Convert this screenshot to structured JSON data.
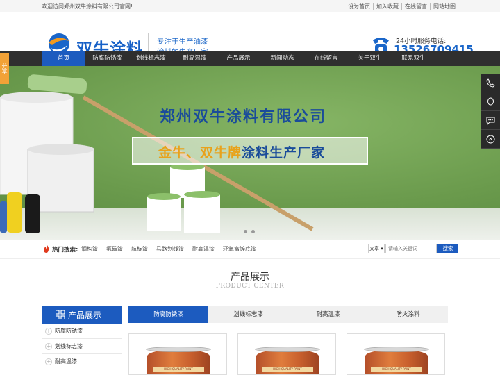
{
  "topbar": {
    "welcome": "欢迎访问郑州双牛涂料有限公司官网!",
    "links": [
      "设为首页",
      "加入收藏",
      "在线留言",
      "网站地图"
    ]
  },
  "header": {
    "brand": "双牛涂料",
    "slogan1": "专注于生产油漆",
    "slogan2": "涂料的生产厂家",
    "hotline_label": "24小时服务电话:",
    "hotline": "13526709415"
  },
  "nav": [
    "首页",
    "防腐防锈漆",
    "划线标志漆",
    "耐高温漆",
    "产品展示",
    "新闻动态",
    "在线留言",
    "关于双牛",
    "联系双牛"
  ],
  "banner": {
    "title": "郑州双牛涂料有限公司",
    "sub_gold": "金牛、双牛牌",
    "sub_blue": "涂料生产厂家"
  },
  "search": {
    "hot_label": "热门搜索:",
    "hot_words": [
      "钢构漆",
      "氟碳漆",
      "航标漆",
      "马路划线漆",
      "耐高温漆",
      "环氧富锌底漆"
    ],
    "select": "文章",
    "placeholder": "请输入关键词",
    "button": "搜索"
  },
  "section": {
    "title": "产品展示",
    "subtitle": "PRODUCT CENTER"
  },
  "sidebar": {
    "title": "产品展示",
    "items": [
      "防腐防锈漆",
      "划线标志漆",
      "耐高温漆"
    ]
  },
  "tabs": [
    "防腐防锈漆",
    "划线标志漆",
    "耐高温漆",
    "防火涂料"
  ],
  "product_label": "HIGH QUALITY PAINT",
  "float": {
    "share": "分享"
  },
  "colors": {
    "primary": "#1c5bbf",
    "nav_bg": "#2f2f2f",
    "share": "#f2a237"
  }
}
